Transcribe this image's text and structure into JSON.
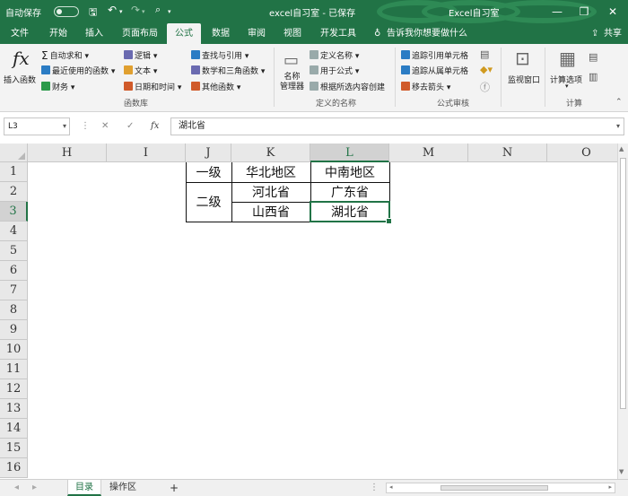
{
  "titlebar": {
    "autosave": "自动保存",
    "doc_title": "excel自习室 - 已保存",
    "app_name": "Excel自习室",
    "minimize": "—",
    "restore": "❐",
    "close": "✕"
  },
  "tabs": [
    "文件",
    "开始",
    "插入",
    "页面布局",
    "公式",
    "数据",
    "审阅",
    "视图",
    "开发工具"
  ],
  "tell_me": "告诉我你想要做什么",
  "share": "共享",
  "ribbon": {
    "insert_function": "插入函数",
    "fx": "fx",
    "autosum": "自动求和",
    "recent": "最近使用的函数",
    "financial": "财务",
    "logical": "逻辑",
    "text": "文本",
    "datetime": "日期和时间",
    "lookup": "查找与引用",
    "math": "数学和三角函数",
    "more": "其他函数",
    "group_library": "函数库",
    "name_manager": "名称\n管理器",
    "define_name": "定义名称",
    "use_in_formula": "用于公式",
    "create_from_selection": "根据所选内容创建",
    "group_names": "定义的名称",
    "trace_precedents": "追踪引用单元格",
    "trace_dependents": "追踪从属单元格",
    "remove_arrows": "移去箭头",
    "group_audit": "公式审核",
    "watch_window": "监视窗口",
    "calc_options": "计算选项",
    "group_calc": "计算"
  },
  "formula_bar": {
    "namebox": "L3",
    "fx": "fx",
    "cancel": "✕",
    "enter": "✓",
    "value": "湖北省"
  },
  "columns": [
    "H",
    "I",
    "J",
    "K",
    "L",
    "M",
    "N",
    "O"
  ],
  "rows": [
    "1",
    "2",
    "3",
    "4",
    "5",
    "6",
    "7",
    "8",
    "9",
    "10",
    "11",
    "12",
    "13",
    "14",
    "15",
    "16"
  ],
  "table": {
    "level1": "一级",
    "level2": "二级",
    "north": "华北地区",
    "south": "中南地区",
    "hebei": "河北省",
    "guangdong": "广东省",
    "shanxi": "山西省",
    "hubei": "湖北省"
  },
  "sheets": [
    "目录",
    "操作区"
  ],
  "add_sheet": "+",
  "colors": {
    "accent": "#217346"
  }
}
